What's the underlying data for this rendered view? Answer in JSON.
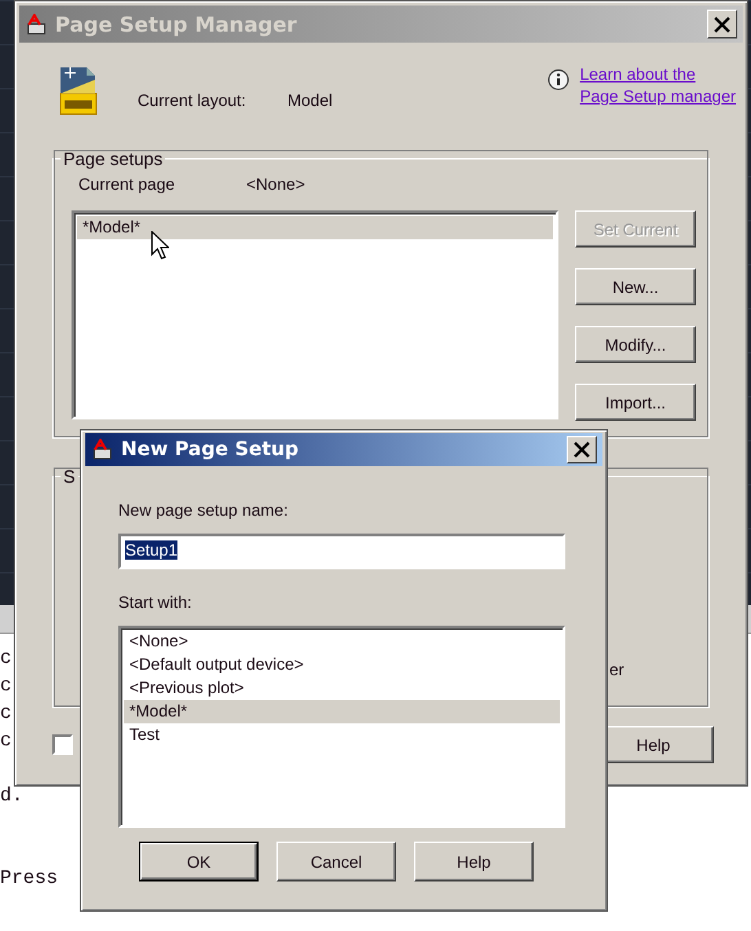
{
  "console": {
    "lines": [
      "c",
      "c",
      "c",
      "c",
      "d.",
      "Press"
    ]
  },
  "page_setup_manager": {
    "title": "Page Setup Manager",
    "current_layout_label": "Current layout:",
    "current_layout": "Model",
    "help_link": [
      "Learn about the",
      "Page Setup manager"
    ],
    "page_setups": {
      "title": "Page setups",
      "current_page_label": "Current page",
      "current_page": "<None>",
      "items": [
        {
          "label": "*Model*",
          "selected": true
        }
      ],
      "buttons": [
        {
          "label": "Set Current",
          "disabled": true
        },
        {
          "label": "New...",
          "disabled": false
        },
        {
          "label": "Modify...",
          "disabled": false
        },
        {
          "label": "Import...",
          "disabled": false
        }
      ]
    },
    "details_group": {
      "title": "S",
      "fragment": "er"
    },
    "checkbox": {
      "checked": false
    },
    "help_button": "Help"
  },
  "new_page_setup": {
    "title": "New Page Setup",
    "name_label": "New page setup name:",
    "name_value": "Setup1",
    "start_with_label": "Start with:",
    "items": [
      {
        "label": "<None>",
        "selected": false
      },
      {
        "label": "<Default output device>",
        "selected": false
      },
      {
        "label": "<Previous plot>",
        "selected": false
      },
      {
        "label": "*Model*",
        "selected": true
      },
      {
        "label": "Test",
        "selected": false
      }
    ],
    "buttons": [
      {
        "label": "OK",
        "default": true
      },
      {
        "label": "Cancel",
        "default": false
      },
      {
        "label": "Help",
        "default": false
      }
    ]
  }
}
